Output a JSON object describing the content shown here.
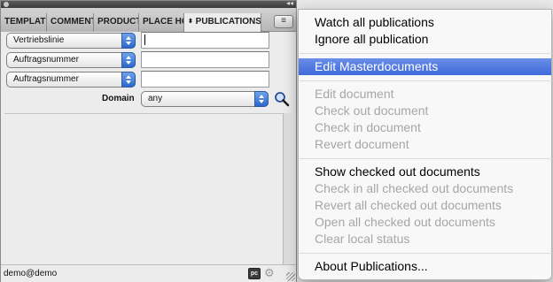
{
  "panel": {
    "tabs": [
      {
        "label": "TEMPLATI"
      },
      {
        "label": "COMMENT"
      },
      {
        "label": "PRODUCT"
      },
      {
        "label": "PLACE HC"
      },
      {
        "label": "PUBLICATIONS",
        "arrows": "⬍"
      }
    ],
    "panel_menu_icon": "≡",
    "collapse_icon": "◂◂",
    "filters": [
      {
        "field": "Vertriebslinie",
        "value": ""
      },
      {
        "field": "Auftragsnummer",
        "value": ""
      },
      {
        "field": "Auftragsnummer",
        "value": ""
      }
    ],
    "domain": {
      "label": "Domain",
      "value": "any"
    },
    "status": {
      "user": "demo@demo",
      "pc_badge": "pc"
    }
  },
  "menu": {
    "items": [
      {
        "label": "Watch all publications",
        "enabled": true
      },
      {
        "label": "Ignore all publication",
        "enabled": true
      },
      {
        "label": "Edit Masterdocuments",
        "enabled": true,
        "highlighted": true
      },
      {
        "label": "Edit document",
        "enabled": false
      },
      {
        "label": "Check out document",
        "enabled": false
      },
      {
        "label": "Check in document",
        "enabled": false
      },
      {
        "label": "Revert document",
        "enabled": false
      },
      {
        "label": "Show checked out documents",
        "enabled": true
      },
      {
        "label": "Check in all checked out documents",
        "enabled": false
      },
      {
        "label": "Revert all checked out documents",
        "enabled": false
      },
      {
        "label": "Open all checked out documents",
        "enabled": false
      },
      {
        "label": "Clear local status",
        "enabled": false
      },
      {
        "label": "About Publications...",
        "enabled": true
      }
    ]
  },
  "colors": {
    "highlight": "#4a73dc",
    "disabled_text": "#a6a6a6",
    "stepper_blue": "#2d66cc"
  },
  "icons": [
    "panel-menu-icon",
    "search-icon",
    "gear-icon",
    "pc-icon",
    "collapse-icon"
  ]
}
